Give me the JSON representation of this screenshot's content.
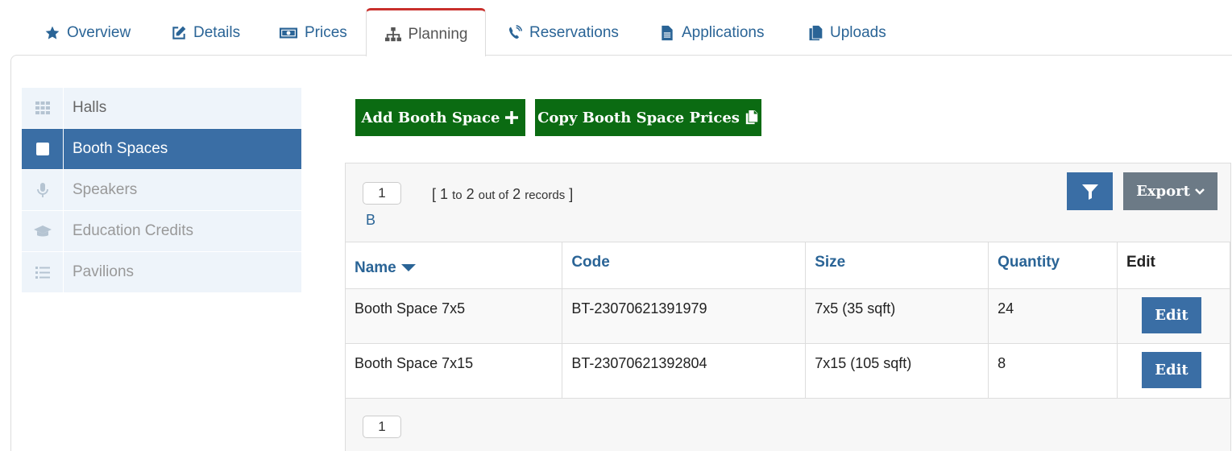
{
  "tabs": [
    {
      "label": "Overview",
      "icon": "star-icon"
    },
    {
      "label": "Details",
      "icon": "edit-icon"
    },
    {
      "label": "Prices",
      "icon": "money-icon"
    },
    {
      "label": "Planning",
      "icon": "sitemap-icon"
    },
    {
      "label": "Reservations",
      "icon": "phone-volume-icon"
    },
    {
      "label": "Applications",
      "icon": "file-icon"
    },
    {
      "label": "Uploads",
      "icon": "copy-icon"
    }
  ],
  "active_tab": "Planning",
  "sidebar": {
    "items": [
      {
        "label": "Halls",
        "icon": "grid-icon"
      },
      {
        "label": "Booth Spaces",
        "icon": "square-icon"
      },
      {
        "label": "Speakers",
        "icon": "microphone-icon"
      },
      {
        "label": "Education Credits",
        "icon": "graduation-cap-icon"
      },
      {
        "label": "Pavilions",
        "icon": "list-icon"
      }
    ],
    "active": "Booth Spaces"
  },
  "actions": {
    "add_label": "Add Booth Space",
    "copy_label": "Copy Booth Space Prices"
  },
  "grid": {
    "page_top": "1",
    "page_top_suffix": "B",
    "records_open": "[",
    "records_from": "1",
    "records_to_word": "to",
    "records_to": "2",
    "records_outof_word": "out of",
    "records_total": "2",
    "records_word": "records",
    "records_close": "]",
    "export_label": "Export",
    "page_bottom": "1",
    "columns": [
      "Name",
      "Code",
      "Size",
      "Quantity",
      "Edit"
    ],
    "rows": [
      {
        "name": "Booth Space 7x5",
        "code": "BT-23070621391979",
        "size": "7x5 (35 sqft)",
        "quantity": "24",
        "edit": "Edit"
      },
      {
        "name": "Booth Space 7x15",
        "code": "BT-23070621392804",
        "size": "7x15 (105 sqft)",
        "quantity": "8",
        "edit": "Edit"
      }
    ]
  },
  "colors": {
    "link_blue": "#2a6496",
    "primary": "#3a6ea5",
    "success": "#0b6b12",
    "secondary": "#6c7a86",
    "tab_accent": "#c9302c"
  }
}
